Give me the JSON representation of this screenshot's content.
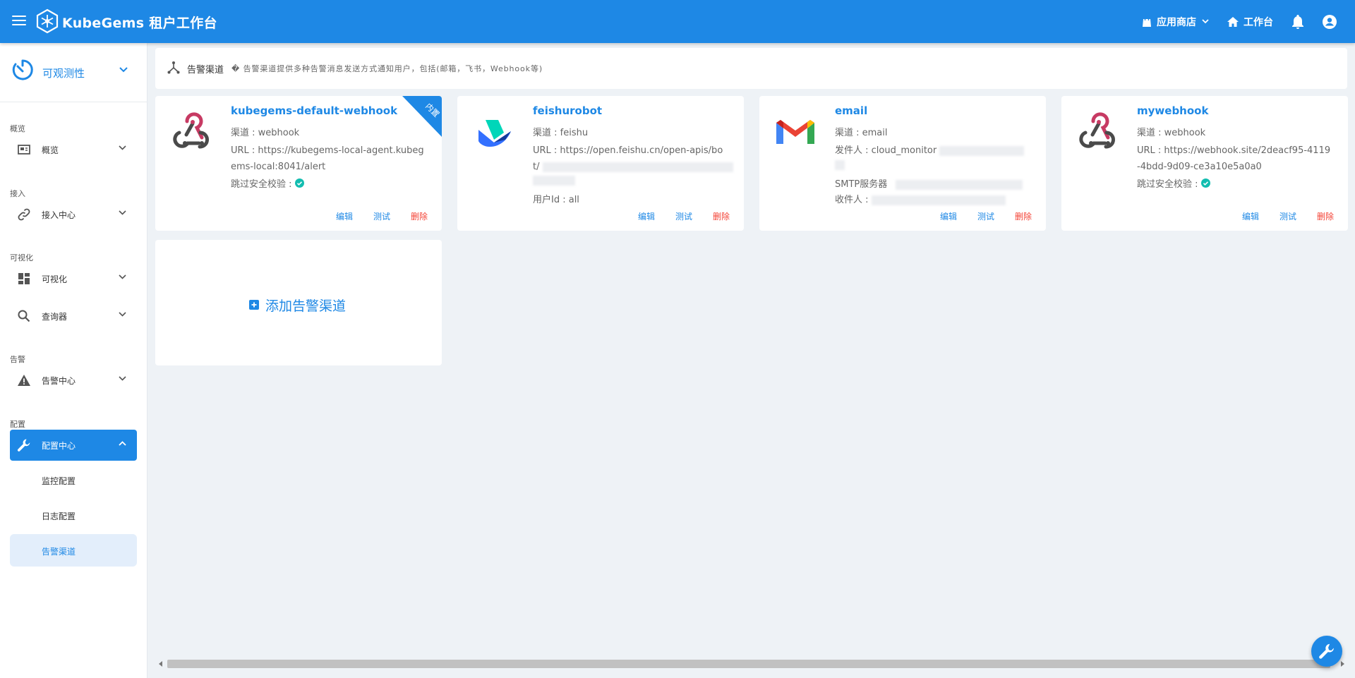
{
  "topbar": {
    "brand": "KubeGems 租户工作台",
    "app_store": "应用商店",
    "workspace": "工作台"
  },
  "sidebar": {
    "header": "可观测性",
    "sections": {
      "overview": "概览",
      "access": "接入",
      "visual": "可视化",
      "alert": "告警",
      "config": "配置"
    },
    "items": {
      "overview": "概览",
      "access_center": "接入中心",
      "visualization": "可视化",
      "query": "查询器",
      "alert_center": "告警中心",
      "config_center": "配置中心"
    },
    "sub_items": [
      "监控配置",
      "日志配置",
      "告警渠道"
    ]
  },
  "header": {
    "title": "告警渠道",
    "description": "� 告警渠道提供多种告警消息发送方式通知用户，包括(邮箱，飞书，Webhook等)"
  },
  "cards": [
    {
      "name": "kubegems-default-webhook",
      "ribbon": "内置",
      "lines": [
        "渠道 : webhook",
        "URL : https://kubegems-local-agent.kubeg",
        "ems-local:8041/alert",
        "跳过安全校验 :"
      ]
    },
    {
      "name": "feishurobot",
      "lines": [
        "渠道 : feishu",
        "URL : https://open.feishu.cn/open-apis/bo",
        "t/",
        "用户Id : all"
      ]
    },
    {
      "name": "email",
      "lines": [
        "渠道 : email",
        "发件人 : cloud_monitor",
        "SMTP服务器",
        "收件人 :"
      ]
    },
    {
      "name": "mywebhook",
      "lines": [
        "渠道 : webhook",
        "URL : https://webhook.site/2deacf95-4119",
        "-4bdd-9d09-ce3a10e5a0a0",
        "跳过安全校验 :"
      ]
    }
  ],
  "actions": {
    "edit": "编辑",
    "test": "测试",
    "delete": "删除"
  },
  "add_card": {
    "label": "添加告警渠道"
  },
  "colors": {
    "primary": "#1e88e5",
    "danger": "#f44336",
    "background": "#eef2f6"
  }
}
